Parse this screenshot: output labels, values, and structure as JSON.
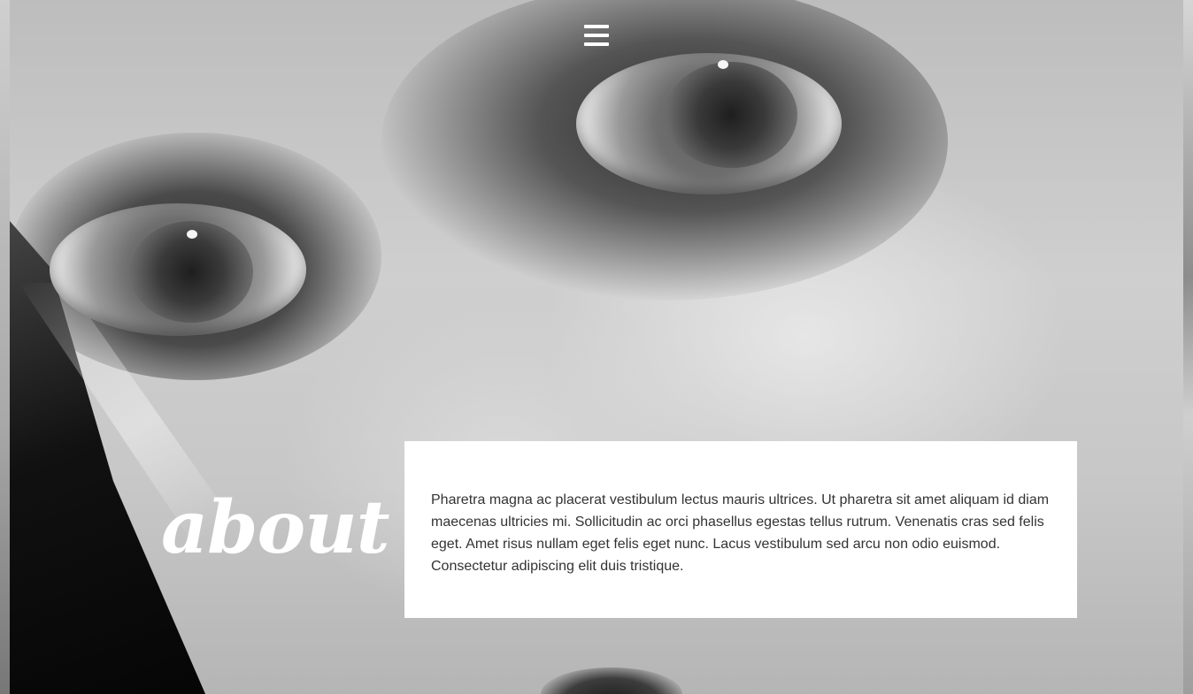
{
  "nav": {
    "menu_icon": "hamburger-menu-icon"
  },
  "about": {
    "title": "about",
    "body": "Pharetra magna ac placerat vestibulum lectus mauris ultrices. Ut pharetra sit amet aliquam id diam maecenas ultricies mi. Sollicitudin ac orci phasellus egestas tellus rutrum. Venenatis cras sed felis eget. Amet risus nullam eget felis eget nunc. Lacus vestibulum sed arcu non odio euismod. Consectetur adipiscing elit duis tristique."
  },
  "colors": {
    "card_background": "#ffffff",
    "title_color": "#ffffff",
    "body_text": "#333333",
    "menu_icon": "#ffffff"
  }
}
